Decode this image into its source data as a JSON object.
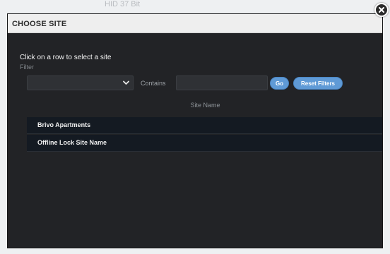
{
  "background": {
    "partial_text": "HID 37 Bit"
  },
  "modal": {
    "title": "CHOOSE SITE",
    "close_icon": "close-icon",
    "instruction": "Click on a row to select a site",
    "filter_label": "Filter",
    "filter_select_value": "",
    "contains_label": "Contains",
    "contains_value": "",
    "go_label": "Go",
    "reset_label": "Reset Filters",
    "table": {
      "column_header": "Site Name",
      "rows": [
        "Brivo Apartments",
        "Offline Lock Site Name"
      ]
    }
  },
  "colors": {
    "modal_bg": "#222326",
    "header_bg": "#eeeeee",
    "button_blue": "#5f9ad6",
    "row_bg": "#141a22"
  }
}
